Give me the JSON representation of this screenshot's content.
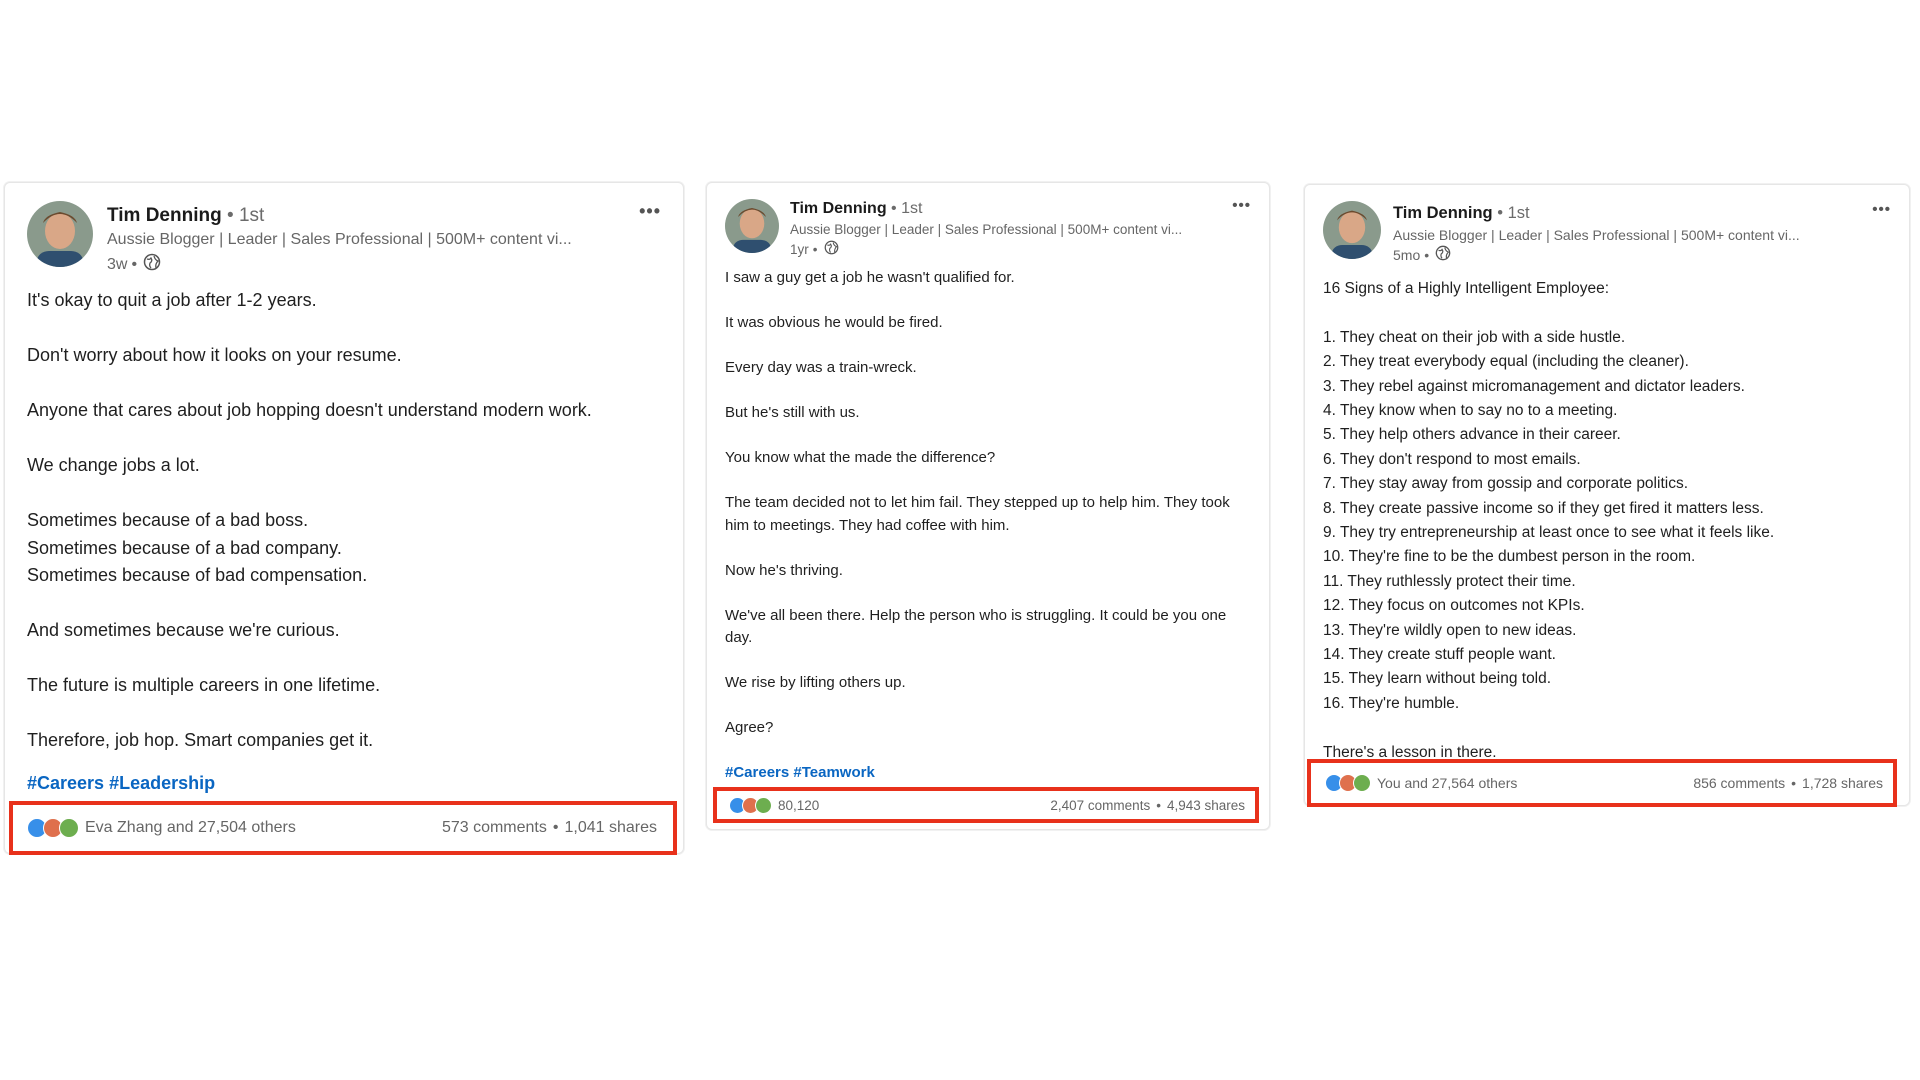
{
  "posts": [
    {
      "author": "Tim Denning",
      "separator": "•",
      "degree": "1st",
      "headline": "Aussie Blogger | Leader | Sales Professional | 500M+ content vi...",
      "time": "3w",
      "more": "•••",
      "paragraphs": [
        "It's okay to quit a job after 1-2 years.",
        "Don't worry about how it looks on your resume.",
        "Anyone that cares about job hopping doesn't understand modern work.",
        "We change jobs a lot.",
        "Sometimes because of a bad boss.\nSometimes because of a bad company.\nSometimes because of bad compensation.",
        "And sometimes because we're curious.",
        "The future is multiple careers in one lifetime.",
        "Therefore, job hop. Smart companies get it."
      ],
      "hashtags": [
        "#Careers",
        "#Leadership"
      ],
      "reactions_text": "Eva Zhang and 27,504 others",
      "comments": "573 comments",
      "shares": "1,041 shares"
    },
    {
      "author": "Tim Denning",
      "separator": "•",
      "degree": "1st",
      "headline": "Aussie Blogger | Leader | Sales Professional | 500M+ content vi...",
      "time": "1yr",
      "more": "•••",
      "paragraphs": [
        "I saw a guy get a job he wasn't qualified for.",
        "It was obvious he would be fired.",
        "Every day was a train-wreck.",
        "But he's still with us.",
        "You know what the made the difference?",
        "The team decided not to let him fail. They stepped up to help him. They took him to meetings. They had coffee with him.",
        "Now he's thriving.",
        "We've all been there. Help the person who is struggling. It could be you one day.",
        "We rise by lifting others up.",
        "Agree?"
      ],
      "hashtags": [
        "#Careers",
        "#Teamwork"
      ],
      "reactions_text": "80,120",
      "comments": "2,407 comments",
      "shares": "4,943 shares"
    },
    {
      "author": "Tim Denning",
      "separator": "•",
      "degree": "1st",
      "headline": "Aussie Blogger | Leader | Sales Professional | 500M+ content vi...",
      "time": "5mo",
      "more": "•••",
      "intro": "16 Signs of a Highly Intelligent Employee:",
      "list": [
        "1. They cheat on their job with a side hustle.",
        "2. They treat everybody equal (including the cleaner).",
        "3. They rebel against micromanagement and dictator leaders.",
        "4. They know when to say no to a meeting.",
        "5. They help others advance in their career.",
        "6. They don't respond to most emails.",
        "7. They stay away from gossip and corporate politics.",
        "8. They create passive income so if they get fired it matters less.",
        "9. They try entrepreneurship at least once to see what it feels like.",
        "10. They're fine to be the dumbest person in the room.",
        "11. They ruthlessly protect their time.",
        "12. They focus on outcomes not KPIs.",
        "13. They're wildly open to new ideas.",
        "14. They create stuff people want.",
        "15. They learn without being told.",
        "16. They're humble."
      ],
      "outro": "There's a lesson in there.",
      "reactions_text": "You and 27,564 others",
      "comments": "856 comments",
      "shares": "1,728 shares"
    }
  ],
  "colors": {
    "highlight_border": "#e8311b",
    "hashtag": "#0a66c2",
    "like": "#378fe9",
    "love": "#df704d",
    "support": "#6dae4f"
  },
  "icons": {
    "globe": "globe-icon",
    "more": "more-options-icon",
    "reactions": [
      "like-icon",
      "love-icon",
      "support-icon"
    ]
  }
}
